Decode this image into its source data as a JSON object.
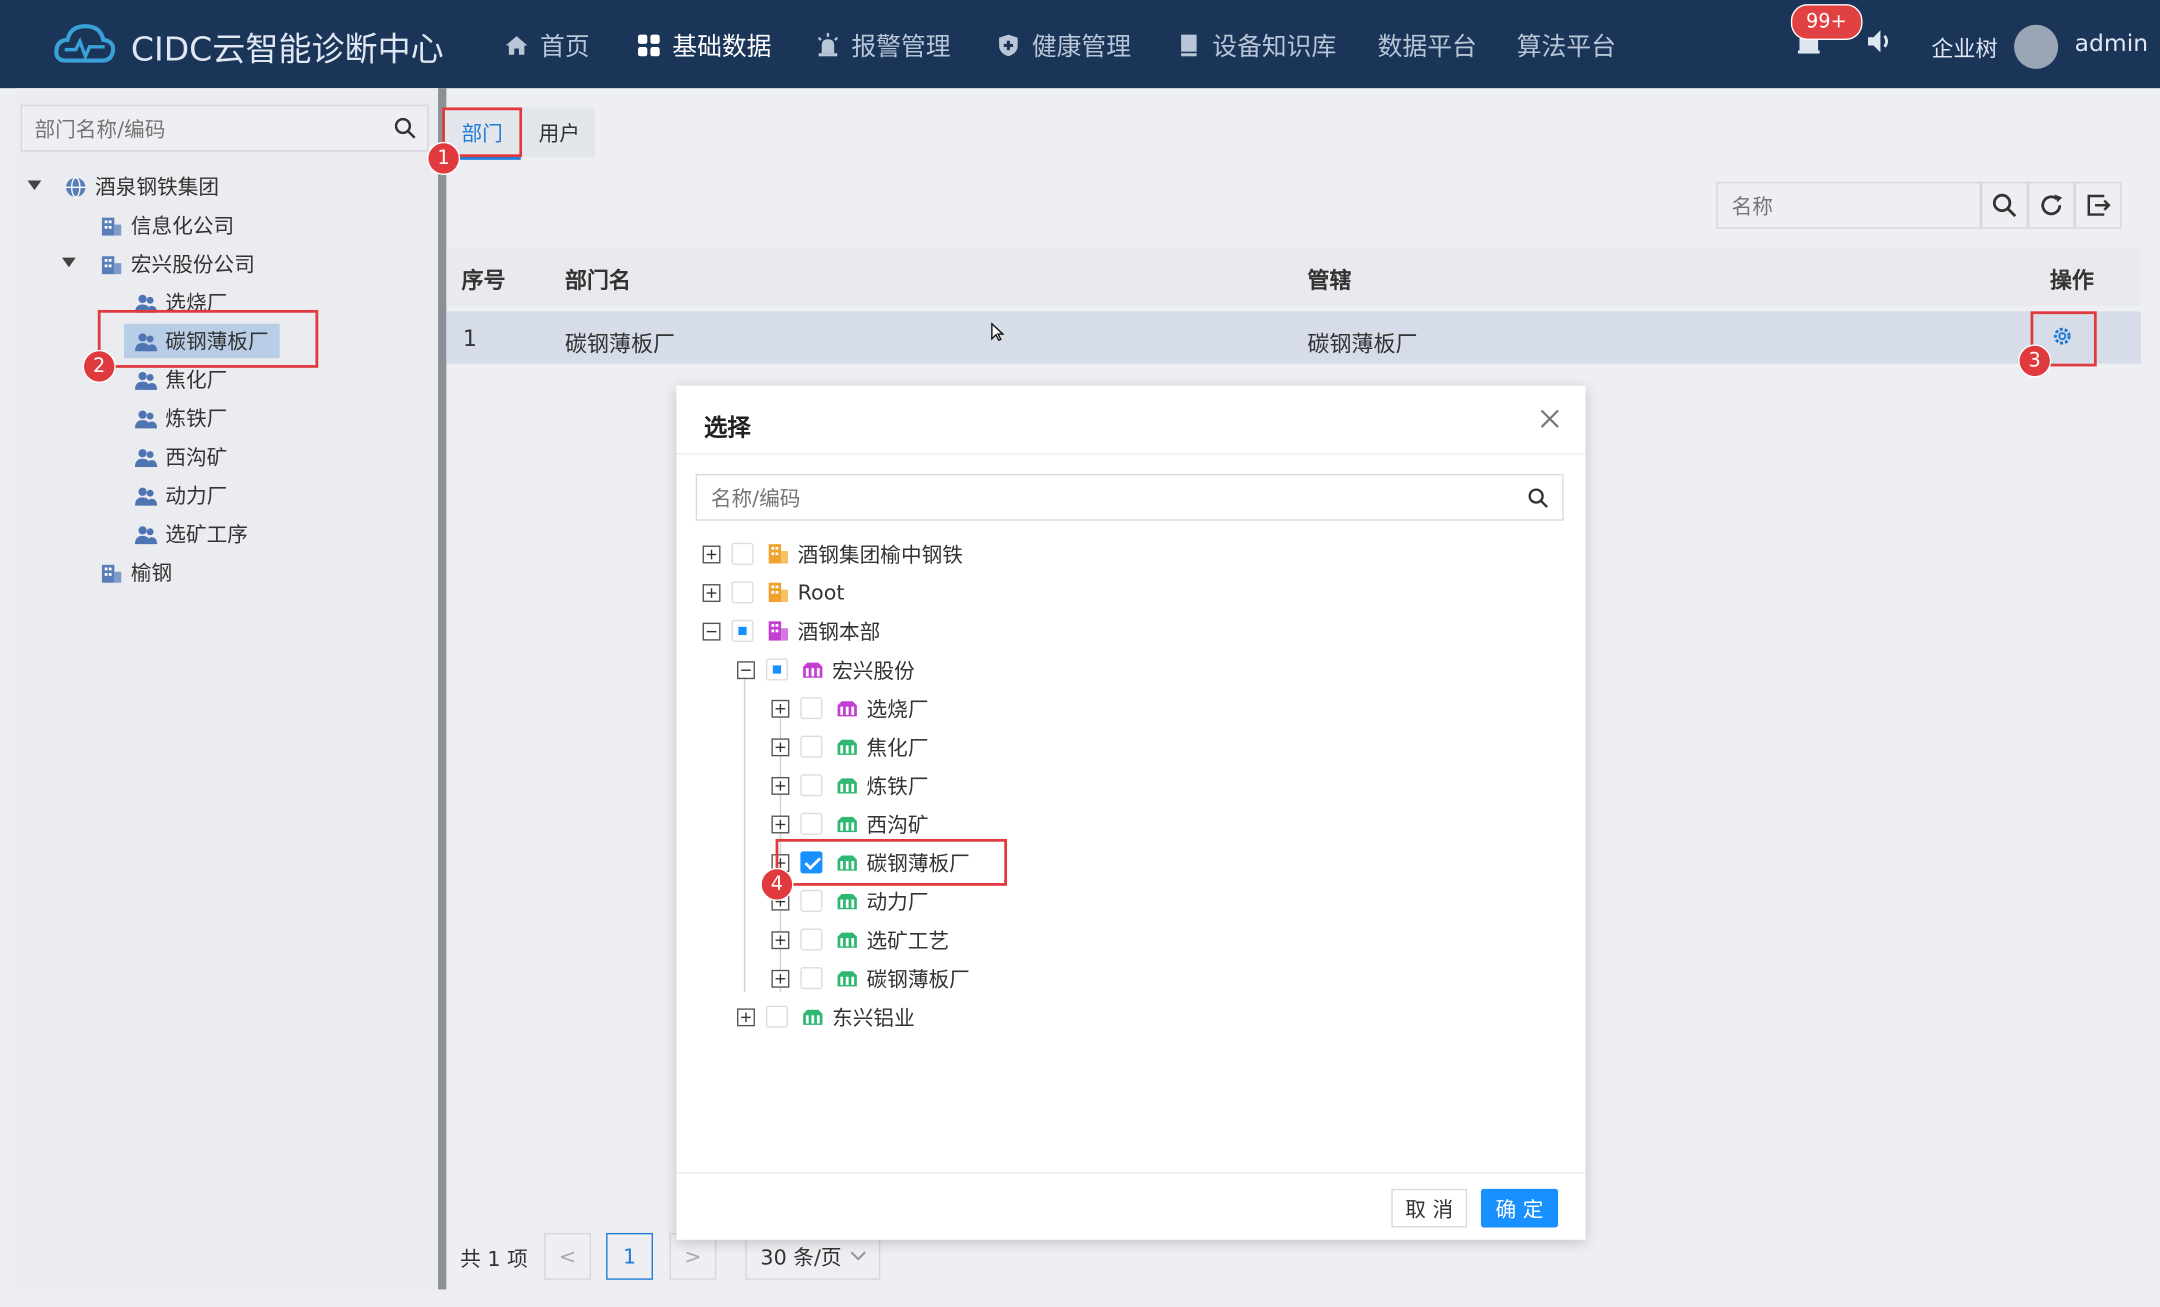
{
  "app": {
    "title": "CIDC云智能诊断中心"
  },
  "nav": {
    "items": [
      {
        "label": "首页",
        "icon": "home-icon"
      },
      {
        "label": "基础数据",
        "icon": "grid-icon",
        "active": true
      },
      {
        "label": "报警管理",
        "icon": "alarm-icon"
      },
      {
        "label": "健康管理",
        "icon": "shield-icon"
      },
      {
        "label": "设备知识库",
        "icon": "book-icon"
      },
      {
        "label": "数据平台"
      },
      {
        "label": "算法平台"
      }
    ],
    "badge": "99+",
    "org_tree_label": "企业树",
    "user": "admin"
  },
  "left": {
    "search_placeholder": "部门名称/编码",
    "tree": [
      {
        "label": "酒泉钢铁集团",
        "icon": "globe-icon"
      },
      {
        "label": "信息化公司",
        "icon": "building-icon"
      },
      {
        "label": "宏兴股份公司",
        "icon": "building-icon"
      },
      {
        "label": "选烧厂",
        "icon": "users-icon"
      },
      {
        "label": "碳钢薄板厂",
        "icon": "users-icon",
        "selected": true
      },
      {
        "label": "焦化厂",
        "icon": "users-icon"
      },
      {
        "label": "炼铁厂",
        "icon": "users-icon"
      },
      {
        "label": "西沟矿",
        "icon": "users-icon"
      },
      {
        "label": "动力厂",
        "icon": "users-icon"
      },
      {
        "label": "选矿工序",
        "icon": "users-icon"
      },
      {
        "label": "榆钢",
        "icon": "building-icon"
      }
    ]
  },
  "tabs": {
    "dept": "部门",
    "user": "用户"
  },
  "toolbar": {
    "name_placeholder": "名称"
  },
  "table": {
    "headers": {
      "index": "序号",
      "name": "部门名",
      "scope": "管辖",
      "ops": "操作"
    },
    "rows": [
      {
        "index": "1",
        "name": "碳钢薄板厂",
        "scope": "碳钢薄板厂"
      }
    ]
  },
  "pagination": {
    "total": "共 1 项",
    "prev": "<",
    "current": "1",
    "next": ">",
    "page_size": "30 条/页"
  },
  "annotations": [
    "1",
    "2",
    "3",
    "4"
  ],
  "modal": {
    "title": "选择",
    "search_placeholder": "名称/编码",
    "tree": [
      {
        "label": "酒钢集团榆中钢铁",
        "icon": "org-icon",
        "level": 0,
        "state": "none",
        "expand": "plus"
      },
      {
        "label": "Root",
        "icon": "org-icon",
        "level": 0,
        "state": "none",
        "expand": "plus"
      },
      {
        "label": "酒钢本部",
        "icon": "org-icon",
        "level": 0,
        "state": "partial",
        "expand": "minus"
      },
      {
        "label": "宏兴股份",
        "icon": "factory-icon",
        "level": 1,
        "state": "partial",
        "expand": "minus"
      },
      {
        "label": "选烧厂",
        "icon": "factory-icon",
        "level": 2,
        "state": "none",
        "expand": "plus"
      },
      {
        "label": "焦化厂",
        "icon": "factory-icon",
        "level": 2,
        "state": "none",
        "expand": "plus"
      },
      {
        "label": "炼铁厂",
        "icon": "factory-icon",
        "level": 2,
        "state": "none",
        "expand": "plus"
      },
      {
        "label": "西沟矿",
        "icon": "factory-icon",
        "level": 2,
        "state": "none",
        "expand": "plus"
      },
      {
        "label": "碳钢薄板厂",
        "icon": "factory-icon",
        "level": 2,
        "state": "checked",
        "expand": "plus"
      },
      {
        "label": "动力厂",
        "icon": "factory-icon",
        "level": 2,
        "state": "none",
        "expand": "plus"
      },
      {
        "label": "选矿工艺",
        "icon": "factory-icon",
        "level": 2,
        "state": "none",
        "expand": "plus"
      },
      {
        "label": "碳钢薄板厂",
        "icon": "factory-icon",
        "level": 2,
        "state": "none",
        "expand": "plus"
      },
      {
        "label": "东兴铝业",
        "icon": "factory-icon",
        "level": 1,
        "state": "none",
        "expand": "plus"
      }
    ],
    "cancel": "取 消",
    "ok": "确 定"
  },
  "colors": {
    "topbar": "#1b3558",
    "primary": "#1890ff",
    "annotation": "#e0393e"
  }
}
